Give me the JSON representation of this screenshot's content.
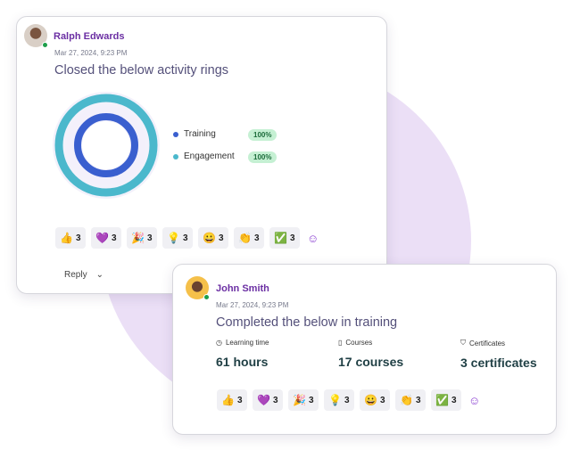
{
  "post1": {
    "author": "Ralph Edwards",
    "timestamp": "Mar 27, 2024, 9:23 PM",
    "message": "Closed the below activity rings",
    "rings": [
      {
        "label": "Training",
        "value": "100%",
        "color": "#3a5fcf"
      },
      {
        "label": "Engagement",
        "value": "100%",
        "color": "#4bb8cc"
      }
    ],
    "reactions": [
      {
        "emoji": "👍",
        "count": "3"
      },
      {
        "emoji": "💜",
        "count": "3"
      },
      {
        "emoji": "🎉",
        "count": "3"
      },
      {
        "emoji": "💡",
        "count": "3"
      },
      {
        "emoji": "😀",
        "count": "3"
      },
      {
        "emoji": "👏",
        "count": "3"
      },
      {
        "emoji": "✅",
        "count": "3"
      }
    ],
    "reply_label": "Reply"
  },
  "post2": {
    "author": "John Smith",
    "timestamp": "Mar 27, 2024, 9:23 PM",
    "message": "Completed the below in training",
    "stats": [
      {
        "label": "Learning time",
        "value": "61 hours",
        "icon": "clock-icon"
      },
      {
        "label": "Courses",
        "value": "17 courses",
        "icon": "book-icon"
      },
      {
        "label": "Certificates",
        "value": "3 certificates",
        "icon": "bookmark-icon"
      }
    ],
    "reactions": [
      {
        "emoji": "👍",
        "count": "3"
      },
      {
        "emoji": "💜",
        "count": "3"
      },
      {
        "emoji": "🎉",
        "count": "3"
      },
      {
        "emoji": "💡",
        "count": "3"
      },
      {
        "emoji": "😀",
        "count": "3"
      },
      {
        "emoji": "👏",
        "count": "3"
      },
      {
        "emoji": "✅",
        "count": "3"
      }
    ]
  },
  "colors": {
    "accent": "#6b2fa3",
    "background_blob": "#ebdff6"
  }
}
